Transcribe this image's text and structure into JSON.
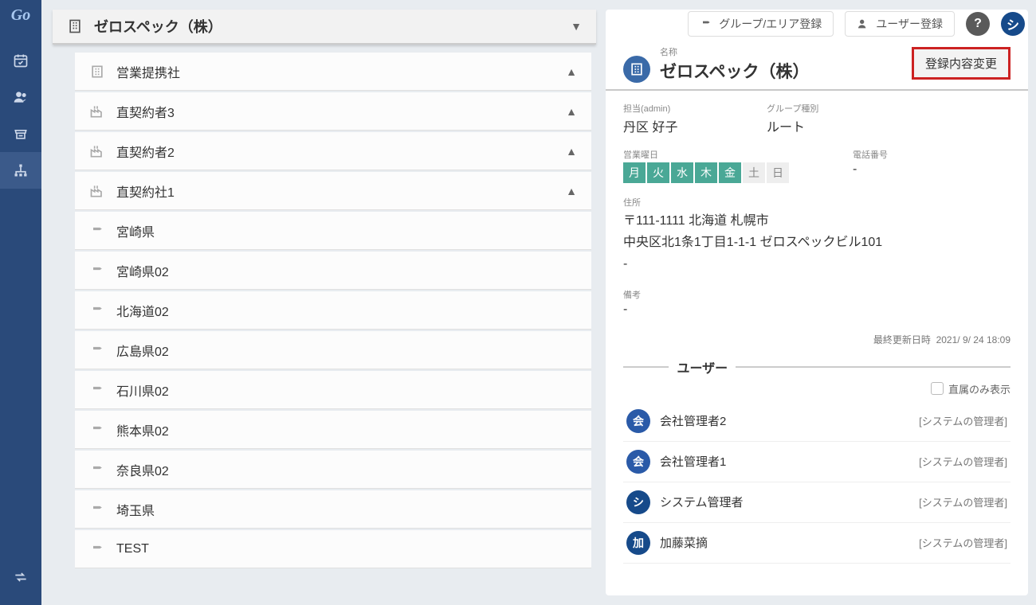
{
  "logo": "Go",
  "topbar": {
    "group_area_btn": "グループ/エリア登録",
    "user_register_btn": "ユーザー登録",
    "help_icon": "?",
    "avatar_letter": "シ"
  },
  "group_header": {
    "title": "ゼロスペック（株）"
  },
  "tree": [
    {
      "icon": "building",
      "label": "営業提携社",
      "collapsible": true
    },
    {
      "icon": "factory",
      "label": "直契約者3",
      "collapsible": true
    },
    {
      "icon": "factory",
      "label": "直契約者2",
      "collapsible": true
    },
    {
      "icon": "factory",
      "label": "直契約社1",
      "collapsible": true
    },
    {
      "icon": "pin",
      "label": "宮崎県",
      "collapsible": false
    },
    {
      "icon": "pin",
      "label": "宮崎県02",
      "collapsible": false
    },
    {
      "icon": "pin",
      "label": "北海道02",
      "collapsible": false
    },
    {
      "icon": "pin",
      "label": "広島県02",
      "collapsible": false
    },
    {
      "icon": "pin",
      "label": "石川県02",
      "collapsible": false
    },
    {
      "icon": "pin",
      "label": "熊本県02",
      "collapsible": false
    },
    {
      "icon": "pin",
      "label": "奈良県02",
      "collapsible": false
    },
    {
      "icon": "pin",
      "label": "埼玉県",
      "collapsible": false
    },
    {
      "icon": "pin",
      "label": "TEST",
      "collapsible": false
    }
  ],
  "detail": {
    "name_label": "名称",
    "name": "ゼロスペック（株）",
    "edit_button": "登録内容変更",
    "admin": {
      "label": "担当(admin)",
      "value": "丹区 好子"
    },
    "group_type": {
      "label": "グループ種別",
      "value": "ルート"
    },
    "days": {
      "label": "営業曜日",
      "values": [
        {
          "t": "月",
          "on": true
        },
        {
          "t": "火",
          "on": true
        },
        {
          "t": "水",
          "on": true
        },
        {
          "t": "木",
          "on": true
        },
        {
          "t": "金",
          "on": true
        },
        {
          "t": "土",
          "on": false
        },
        {
          "t": "日",
          "on": false
        }
      ]
    },
    "phone": {
      "label": "電話番号",
      "value": "-"
    },
    "address": {
      "label": "住所",
      "line1": "〒111-1111 北海道 札幌市",
      "line2": "中央区北1条1丁目1-1-1 ゼロスペックビル101",
      "line3": "-"
    },
    "note": {
      "label": "備考",
      "value": "-"
    },
    "last_updated": {
      "label": "最終更新日時",
      "value": "2021/ 9/ 24 18:09"
    },
    "user_section_label": "ユーザー",
    "direct_only_label": "直属のみ表示",
    "users": [
      {
        "badge": "会",
        "badgeClass": "badge-kai",
        "name": "会社管理者2",
        "role": "[システムの管理者]"
      },
      {
        "badge": "会",
        "badgeClass": "badge-kai",
        "name": "会社管理者1",
        "role": "[システムの管理者]"
      },
      {
        "badge": "シ",
        "badgeClass": "badge-shi",
        "name": "システム管理者",
        "role": "[システムの管理者]"
      },
      {
        "badge": "加",
        "badgeClass": "badge-ka",
        "name": "加藤菜摘",
        "role": "[システムの管理者]"
      }
    ]
  }
}
